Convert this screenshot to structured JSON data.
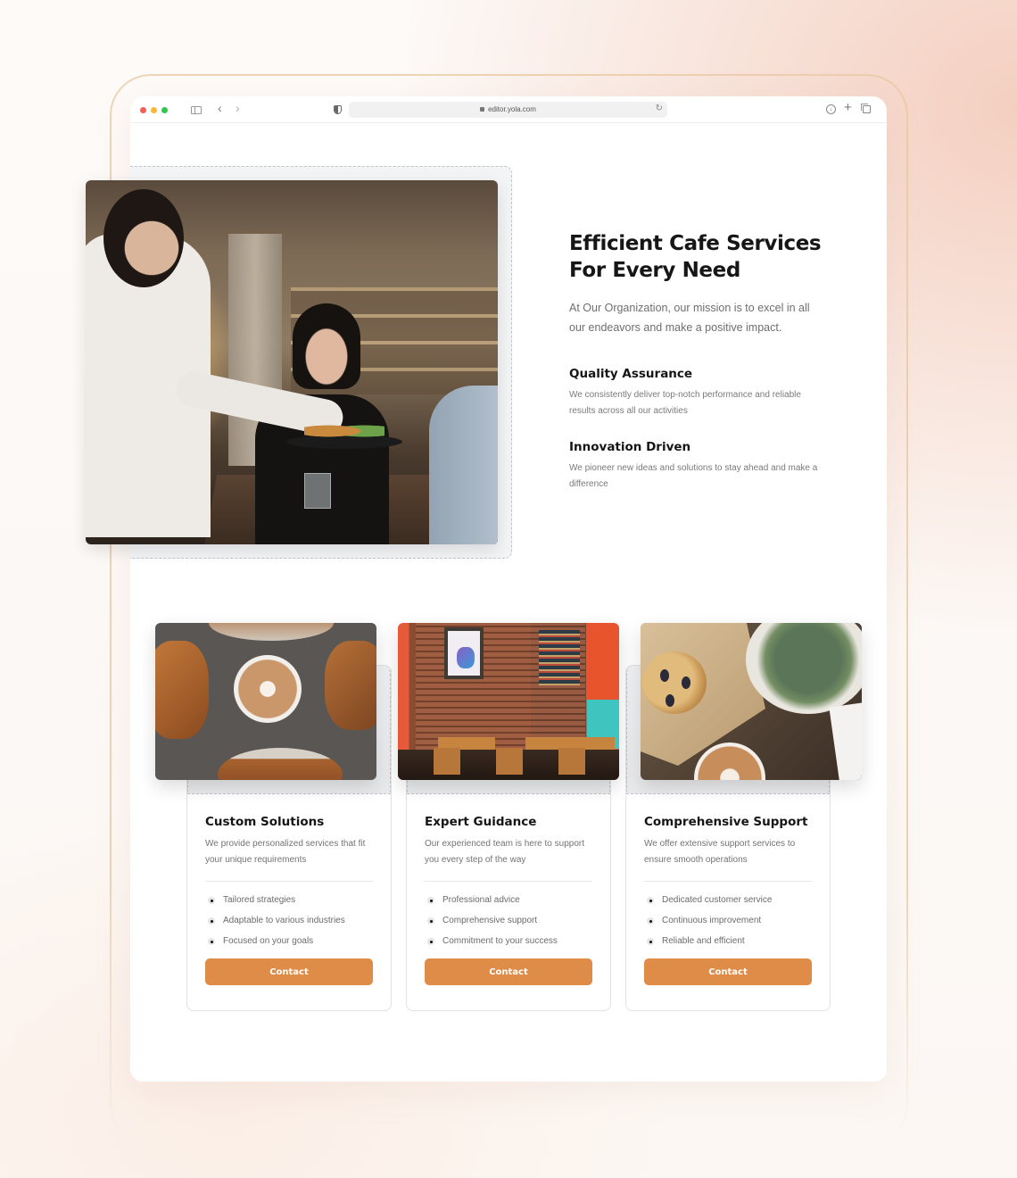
{
  "browser": {
    "url": "editor.yola.com",
    "icons": {
      "window_controls": [
        "close",
        "minimize",
        "zoom"
      ],
      "sidebar": "sidebar-icon",
      "back": "chevron-left-icon",
      "forward": "chevron-right-icon",
      "privacy": "shield-icon",
      "lock": "lock-icon",
      "reload": "reload-icon",
      "download": "download-icon",
      "new_tab": "plus-icon",
      "tabs": "tabs-overview-icon"
    },
    "glyphs": {
      "back": "‹",
      "forward": "›",
      "reload": "↻",
      "download": "↓",
      "plus": "+"
    }
  },
  "hero": {
    "title_line1": "Efficient Cafe Services",
    "title_line2": "For Every Need",
    "description": "At Our Organization, our mission is to excel in all our endeavors and make a positive impact.",
    "image": "waitress-serving-customer-photo",
    "features": [
      {
        "title": "Quality Assurance",
        "description": "We consistently deliver top-notch performance and reliable results across all our activities"
      },
      {
        "title": "Innovation Driven",
        "description": "We pioneer new ideas and solutions to stay ahead and make a difference"
      }
    ]
  },
  "cards": [
    {
      "image": "croissants-and-latte-photo",
      "title": "Custom Solutions",
      "description": "We provide personalized services that fit your unique requirements",
      "bullets": [
        "Tailored strategies",
        "Adaptable to various industries",
        "Focused on your goals"
      ],
      "button": "Contact"
    },
    {
      "image": "restaurant-interior-photo",
      "title": "Expert Guidance",
      "description": "Our experienced team is here to support you every step of the way",
      "bullets": [
        "Professional advice",
        "Comprehensive support",
        "Commitment to your success"
      ],
      "button": "Contact"
    },
    {
      "image": "muffin-and-succulent-photo",
      "title": "Comprehensive Support",
      "description": "We offer extensive support services to ensure smooth operations",
      "bullets": [
        "Dedicated customer service",
        "Continuous improvement",
        "Reliable and efficient"
      ],
      "button": "Contact"
    }
  ],
  "colors": {
    "accent": "#df8c48",
    "heading": "#161616",
    "body_text": "#6e6e6e",
    "traffic_red": "#f45e57",
    "traffic_yellow": "#fbb735",
    "traffic_green": "#2fc84a"
  }
}
